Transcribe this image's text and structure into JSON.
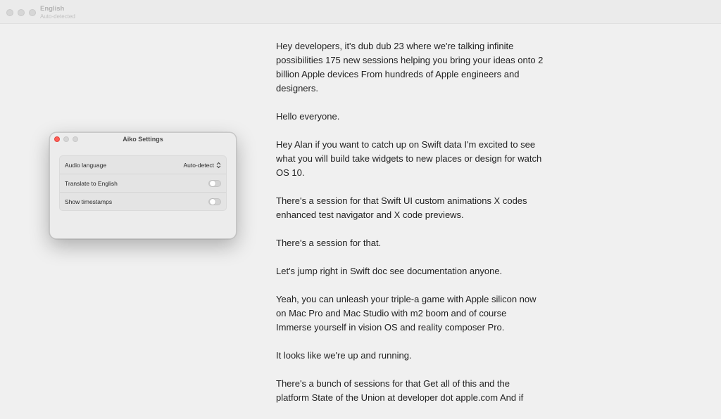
{
  "window": {
    "title": "English",
    "subtitle": "Auto-detected"
  },
  "transcript": [
    "Hey developers, it's dub dub 23 where we're talking infinite possibilities 175 new sessions helping you bring your ideas onto 2 billion Apple devices From hundreds of Apple engineers and designers.",
    "Hello everyone.",
    "Hey Alan if you want to catch up on Swift data I'm excited to see what you will build take widgets to new places or design for watch OS 10.",
    "There's a session for that Swift UI custom animations X codes enhanced test navigator and X code previews.",
    "There's a session for that.",
    "Let's jump right in Swift doc see documentation anyone.",
    "Yeah, you can unleash your triple-a game with Apple silicon now on Mac Pro and Mac Studio with m2 boom and of course Immerse yourself in vision OS and reality composer Pro.",
    "It looks like we're up and running.",
    "There's a bunch of sessions for that Get all of this and the platform State of the Union at developer dot apple.com And if"
  ],
  "settings": {
    "title": "Aiko Settings",
    "audio_language_label": "Audio language",
    "audio_language_value": "Auto-detect",
    "translate_label": "Translate to English",
    "translate_on": false,
    "timestamps_label": "Show timestamps",
    "timestamps_on": false
  },
  "colors": {
    "close_button": "#ff5f57",
    "background": "#f0f0f0"
  }
}
